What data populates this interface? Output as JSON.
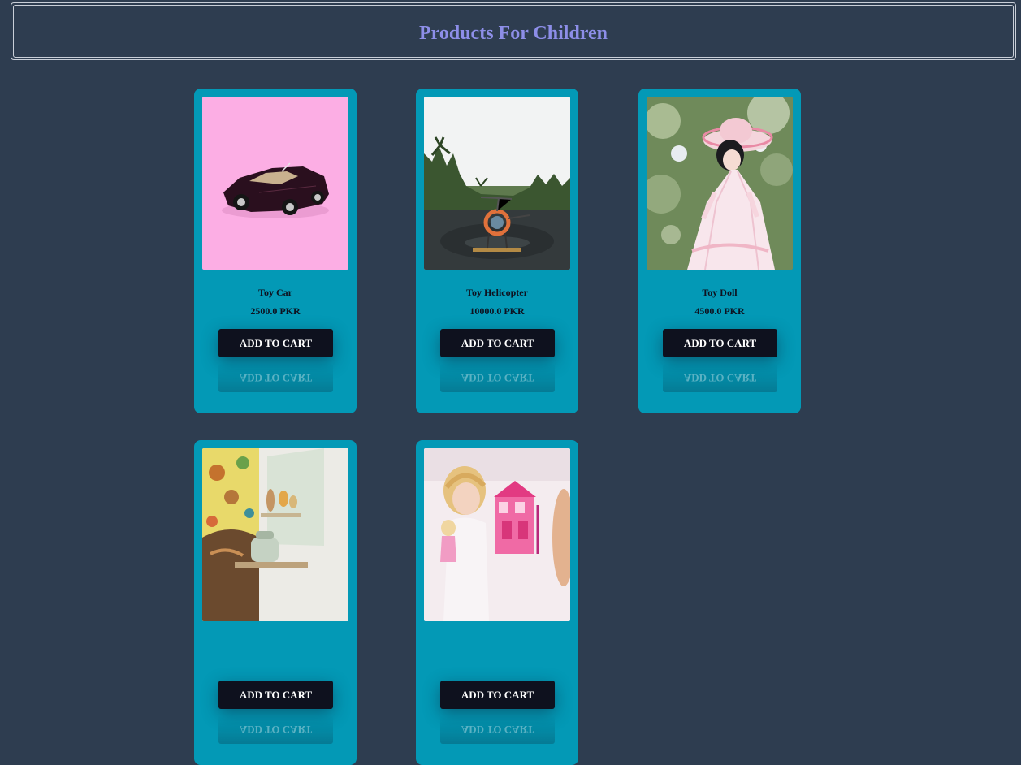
{
  "header": {
    "title": "Products For Children"
  },
  "products": [
    {
      "name": "Toy Car",
      "price": "2500.0 PKR",
      "button_label": "ADD TO CART"
    },
    {
      "name": "Toy Helicopter",
      "price": "10000.0 PKR",
      "button_label": "ADD TO CART"
    },
    {
      "name": "Toy Doll",
      "price": "4500.0 PKR",
      "button_label": "ADD TO CART"
    },
    {
      "name": "",
      "price": "",
      "button_label": "ADD TO CART"
    },
    {
      "name": "",
      "price": "",
      "button_label": "ADD TO CART"
    }
  ],
  "colors": {
    "background": "#2e3d50",
    "card": "#0399b6",
    "title": "#8d8ee8",
    "button": "#0e111e"
  }
}
